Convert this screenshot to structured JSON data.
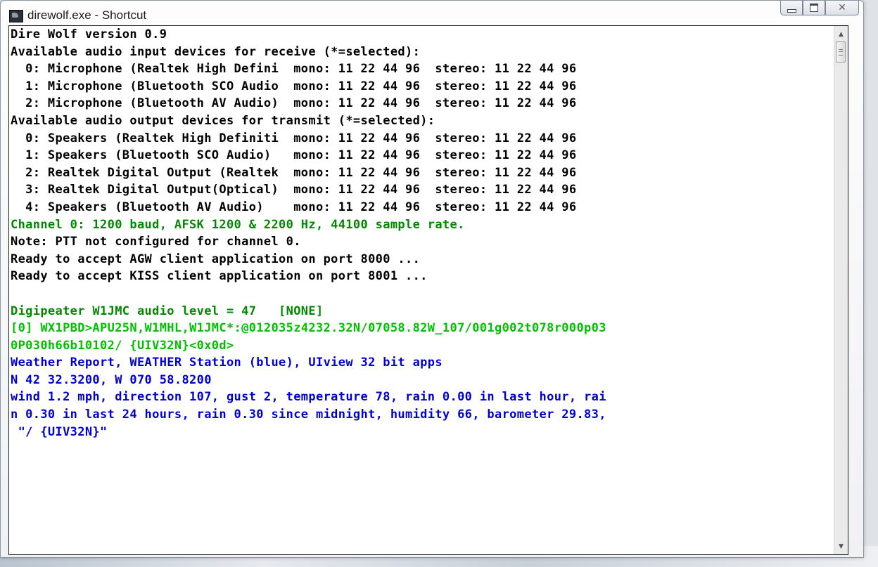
{
  "window": {
    "title": "direwolf.exe - Shortcut"
  },
  "colors": {
    "default": "#000000",
    "green": "#008800",
    "lime": "#00c000",
    "blue": "#0000d0"
  },
  "console": {
    "lines": [
      {
        "text": "Dire Wolf version 0.9",
        "color": "default"
      },
      {
        "text": "Available audio input devices for receive (*=selected):",
        "color": "default"
      },
      {
        "text": "  0: Microphone (Realtek High Defini  mono: 11 22 44 96  stereo: 11 22 44 96",
        "color": "default"
      },
      {
        "text": "  1: Microphone (Bluetooth SCO Audio  mono: 11 22 44 96  stereo: 11 22 44 96",
        "color": "default"
      },
      {
        "text": "  2: Microphone (Bluetooth AV Audio)  mono: 11 22 44 96  stereo: 11 22 44 96",
        "color": "default"
      },
      {
        "text": "Available audio output devices for transmit (*=selected):",
        "color": "default"
      },
      {
        "text": "  0: Speakers (Realtek High Definiti  mono: 11 22 44 96  stereo: 11 22 44 96",
        "color": "default"
      },
      {
        "text": "  1: Speakers (Bluetooth SCO Audio)   mono: 11 22 44 96  stereo: 11 22 44 96",
        "color": "default"
      },
      {
        "text": "  2: Realtek Digital Output (Realtek  mono: 11 22 44 96  stereo: 11 22 44 96",
        "color": "default"
      },
      {
        "text": "  3: Realtek Digital Output(Optical)  mono: 11 22 44 96  stereo: 11 22 44 96",
        "color": "default"
      },
      {
        "text": "  4: Speakers (Bluetooth AV Audio)    mono: 11 22 44 96  stereo: 11 22 44 96",
        "color": "default"
      },
      {
        "text": "Channel 0: 1200 baud, AFSK 1200 & 2200 Hz, 44100 sample rate.",
        "color": "green"
      },
      {
        "text": "Note: PTT not configured for channel 0.",
        "color": "default"
      },
      {
        "text": "Ready to accept AGW client application on port 8000 ...",
        "color": "default"
      },
      {
        "text": "Ready to accept KISS client application on port 8001 ...",
        "color": "default"
      },
      {
        "text": "",
        "color": "default"
      },
      {
        "text": "Digipeater W1JMC audio level = 47   [NONE]",
        "color": "green"
      },
      {
        "text": "[0] WX1PBD>APU25N,W1MHL,W1JMC*:@012035z4232.32N/07058.82W_107/001g002t078r000p03",
        "color": "lime"
      },
      {
        "text": "0P030h66b10102/ {UIV32N}<0x0d>",
        "color": "lime"
      },
      {
        "text": "Weather Report, WEATHER Station (blue), UIview 32 bit apps",
        "color": "blue"
      },
      {
        "text": "N 42 32.3200, W 070 58.8200",
        "color": "blue"
      },
      {
        "text": "wind 1.2 mph, direction 107, gust 2, temperature 78, rain 0.00 in last hour, rai",
        "color": "blue"
      },
      {
        "text": "n 0.30 in last 24 hours, rain 0.30 since midnight, humidity 66, barometer 29.83,",
        "color": "blue"
      },
      {
        "text": " \"/ {UIV32N}\"",
        "color": "blue"
      }
    ]
  },
  "controls": {
    "minimize_icon": "minimize-icon",
    "maximize_icon": "maximize-icon",
    "close_icon": "close-icon",
    "close_glyph": "✕"
  }
}
